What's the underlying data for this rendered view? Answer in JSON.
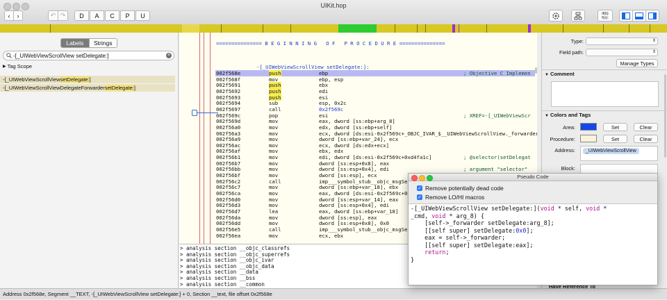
{
  "window": {
    "title": "UIKit.hop"
  },
  "toolbar": {
    "segments": [
      "D",
      "A",
      "C",
      "P",
      "U"
    ],
    "back": "‹",
    "fwd": "›",
    "undo": "↶",
    "redo": "↷",
    "ifb": "if(b)\nf(x);"
  },
  "left": {
    "tabs": [
      "Labels",
      "Strings"
    ],
    "search_value": "-[_UIWebViewScrollView setDelegate:]",
    "tag_scope": "Tag Scope",
    "results": [
      {
        "pre": "-[_UIWebViewScrollView ",
        "hl": "setDelegate:",
        "post": "]"
      },
      {
        "pre": "-[_UIWebViewScrollViewDelegateForwarder ",
        "hl": "setDelegate:",
        "post": "]"
      }
    ]
  },
  "disasm": {
    "banner": "=============== B E G I N N I N G   O F   P R O C E D U R E ===============",
    "proc": "-[_UIWebViewScrollView setDelegate:]:",
    "lines": [
      {
        "a": "002f568e",
        "m": "push",
        "o": "ebp",
        "c": "; Objective C Implemen",
        "hl": true
      },
      {
        "a": "002f568f",
        "m": "mov",
        "o": "ebp, esp",
        "c": ""
      },
      {
        "a": "002f5691",
        "m": "push",
        "o": "ebx",
        "c": "",
        "mh": true
      },
      {
        "a": "002f5692",
        "m": "push",
        "o": "edi",
        "c": "",
        "mh": true
      },
      {
        "a": "002f5693",
        "m": "push",
        "o": "esi",
        "c": "",
        "mh": true
      },
      {
        "a": "002f5694",
        "m": "sub",
        "o": "esp, 0x2c",
        "c": ""
      },
      {
        "a": "002f5697",
        "m": "call",
        "o": "0x2f569c",
        "c": "",
        "ob": true
      },
      {
        "a": "002f569c",
        "m": "pop",
        "o": "esi",
        "c": "; XREF=-[_UIWebViewScr"
      },
      {
        "a": "002f569d",
        "m": "mov",
        "o": "eax, dword [ss:ebp+arg_8]",
        "c": ""
      },
      {
        "a": "002f56a0",
        "m": "mov",
        "o": "edx, dword [ss:ebp+self]",
        "c": ""
      },
      {
        "a": "002f56a3",
        "m": "mov",
        "o": "ecx, dword [ds:esi-0x2f569c+_OBJC_IVAR_$__UIWebViewScrollView._forwarder]",
        "c": ""
      },
      {
        "a": "002f56a9",
        "m": "mov",
        "o": "dword [ss:ebp+var_24], ecx",
        "c": ""
      },
      {
        "a": "002f56ac",
        "m": "mov",
        "o": "ecx, dword [ds:edx+ecx]",
        "c": ""
      },
      {
        "a": "002f56af",
        "m": "mov",
        "o": "ebx, edx",
        "c": ""
      },
      {
        "a": "002f56b1",
        "m": "mov",
        "o": "edi, dword [ds:esi-0x2f569c+0xd4fa1c]",
        "c": "; @selector(setDelegat"
      },
      {
        "a": "002f56b7",
        "m": "mov",
        "o": "dword [ss:esp+0x8], eax",
        "c": ""
      },
      {
        "a": "002f56bb",
        "m": "mov",
        "o": "dword [ss:esp+0x4], edi",
        "c": "; argument \"selector\""
      },
      {
        "a": "002f56bf",
        "m": "mov",
        "o": "dword [ss:esp], ecx",
        "c": ""
      },
      {
        "a": "002f56c2",
        "m": "call",
        "o": "imp___symbol_stub__objc_msgSend",
        "c": ""
      },
      {
        "a": "002f56c7",
        "m": "mov",
        "o": "dword [ss:ebp+var_18], ebx",
        "c": ""
      },
      {
        "a": "002f56ca",
        "m": "mov",
        "o": "eax, dword [ds:esi-0x2f569c+0xd677",
        "c": ""
      },
      {
        "a": "002f56d0",
        "m": "mov",
        "o": "dword [ss:esp+var_14], eax",
        "c": ""
      },
      {
        "a": "002f56d3",
        "m": "mov",
        "o": "dword [ss:esp+0x4], edi",
        "c": ""
      },
      {
        "a": "002f56d7",
        "m": "lea",
        "o": "eax, dword [ss:ebp+var_18]",
        "c": ""
      },
      {
        "a": "002f56da",
        "m": "mov",
        "o": "dword [ss:esp], eax",
        "c": ""
      },
      {
        "a": "002f56dd",
        "m": "mov",
        "o": "dword [ss:esp+0x8], 0x0",
        "c": ""
      },
      {
        "a": "002f56e5",
        "m": "call",
        "o": "imp___symbol_stub__objc_msgSendSup",
        "c": ""
      },
      {
        "a": "002f56ea",
        "m": "mov",
        "o": "ecx, ebx",
        "c": ""
      }
    ]
  },
  "console": {
    "lines": [
      "> analysis section __objc_classrefs",
      "> analysis section __objc_superrefs",
      "> analysis section __objc_ivar",
      "> analysis section __objc_data",
      "> analysis section __data",
      "> analysis section __bss",
      "> analysis section __common"
    ]
  },
  "right": {
    "type_label": "Type:",
    "field_path_label": "Field path:",
    "manage_types": "Manage Types",
    "comment_header": "Comment",
    "colors_header": "Colors and Tags",
    "area_label": "Area:",
    "procedure_label": "Procedure:",
    "set": "Set",
    "clear": "Clear",
    "area_color": "#1447e8",
    "procedure_color": "#fbf3da",
    "address_label": "Address:",
    "address_tag": "_UIWebViewScrollView",
    "block_label": "Block:",
    "have_ref": "Have Reference To"
  },
  "pseudo": {
    "title": "Pseudo Code",
    "opt1": "Remove potentially dead code",
    "opt2": "Remove LO/HI macros",
    "code": [
      [
        {
          "t": "-[_UIWebViewScrollView setDelegate:](",
          "c": ""
        },
        {
          "t": "void",
          "c": "kw"
        },
        {
          "t": " * self, ",
          "c": ""
        },
        {
          "t": "void",
          "c": "kw"
        },
        {
          "t": " *",
          "c": ""
        }
      ],
      [
        {
          "t": "_cmd, ",
          "c": ""
        },
        {
          "t": "void",
          "c": "kw"
        },
        {
          "t": " * arg_8) {",
          "c": ""
        }
      ],
      [
        {
          "t": "    [self->_forwarder setDelegate:arg_8];",
          "c": ""
        }
      ],
      [
        {
          "t": "    [[self super] setDelegate:",
          "c": ""
        },
        {
          "t": "0x0",
          "c": "nm"
        },
        {
          "t": "];",
          "c": ""
        }
      ],
      [
        {
          "t": "    eax = self->_forwarder;",
          "c": ""
        }
      ],
      [
        {
          "t": "    [[self super] setDelegate:eax];",
          "c": ""
        }
      ],
      [
        {
          "t": "    ",
          "c": ""
        },
        {
          "t": "return",
          "c": "kw"
        },
        {
          "t": ";",
          "c": ""
        }
      ],
      [
        {
          "t": "}",
          "c": ""
        }
      ]
    ]
  },
  "status": "Address 0x2f568e, Segment __TEXT, -[_UIWebViewScrollView setDelegate:] + 0, Section __text, file offset 0x2f568e"
}
